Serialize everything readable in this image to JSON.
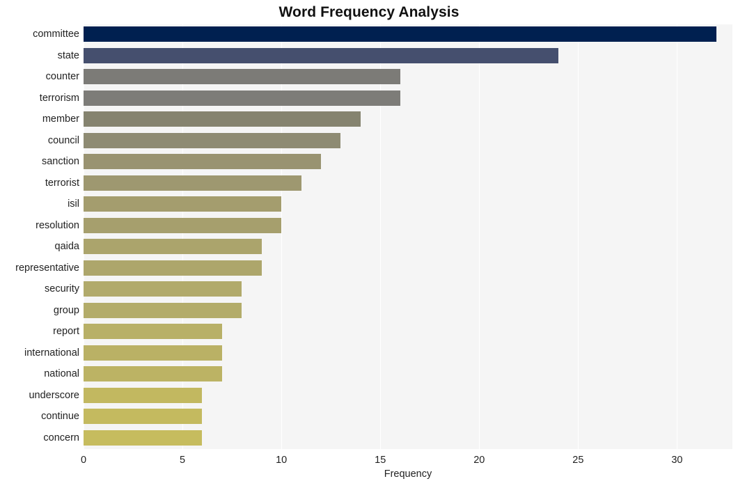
{
  "chart_data": {
    "type": "bar",
    "orientation": "horizontal",
    "title": "Word Frequency Analysis",
    "xlabel": "Frequency",
    "ylabel": "",
    "categories": [
      "committee",
      "state",
      "counter",
      "terrorism",
      "member",
      "council",
      "sanction",
      "terrorist",
      "isil",
      "resolution",
      "qaida",
      "representative",
      "security",
      "group",
      "report",
      "international",
      "national",
      "underscore",
      "continue",
      "concern"
    ],
    "values": [
      32,
      24,
      16,
      16,
      14,
      13,
      12,
      11,
      10,
      10,
      9,
      9,
      8,
      8,
      7,
      7,
      7,
      6,
      6,
      6
    ],
    "bar_colors": [
      "#002050",
      "#454f6e",
      "#7c7b77",
      "#7d7c78",
      "#85836f",
      "#8e8b73",
      "#999371",
      "#9e9870",
      "#a49d6e",
      "#a69f6d",
      "#aba46c",
      "#ada66b",
      "#b1aa6b",
      "#b3ac6a",
      "#b8b067",
      "#bab165",
      "#bcb364",
      "#c2b860",
      "#c4ba5f",
      "#c6bc5e"
    ],
    "xticks": [
      0,
      5,
      10,
      15,
      20,
      25,
      30
    ],
    "xlim": [
      0,
      32.8
    ],
    "grid": true,
    "grid_axis": "x",
    "legend": "none",
    "plot_background": "#f5f5f5",
    "figure_background": "#ffffff"
  }
}
